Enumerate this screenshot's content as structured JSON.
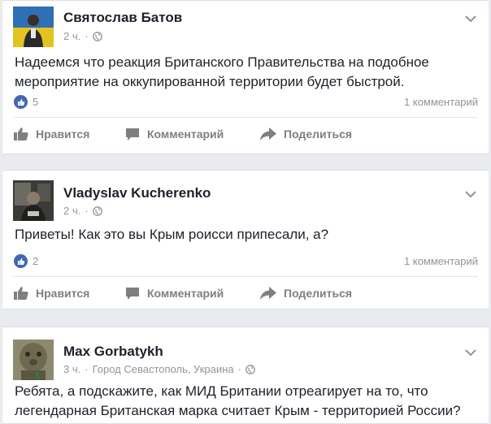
{
  "posts": [
    {
      "author": "Святослав Батов",
      "time": "2 ч.",
      "text": "Надеемся что реакция Британского Правительства на подобное мероприятие на оккупированной территории будет быстрой.",
      "likes": "5",
      "comments": "1 комментарий"
    },
    {
      "author": "Vladyslav Kucherenko",
      "time": "2 ч.",
      "text": "Приветы! Как это вы Крым роисси припесали, а?",
      "likes": "2",
      "comments": "1 комментарий"
    },
    {
      "author": "Max Gorbatykh",
      "time": "3 ч.",
      "location": "Город Севастополь, Украина",
      "text": "Ребята, а подскажите, как МИД Британии отреагирует на то, что легендарная Британская марка считает Крым - территорией России?"
    }
  ],
  "actions": {
    "like": "Нравится",
    "comment": "Комментарий",
    "share": "Поделиться"
  },
  "separator": "·",
  "colors": {
    "link_blue": "#4267b2",
    "meta_gray": "#90949c",
    "action_gray": "#7f7f7f"
  }
}
